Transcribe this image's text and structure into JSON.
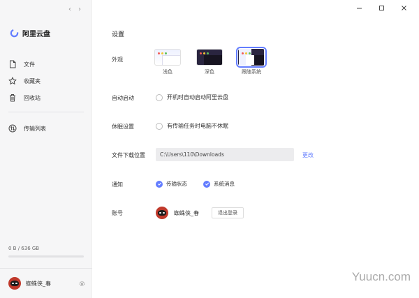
{
  "app": {
    "name": "阿里云盘"
  },
  "sidebar": {
    "items": [
      {
        "label": "文件",
        "icon": "file-icon"
      },
      {
        "label": "收藏夹",
        "icon": "star-icon"
      },
      {
        "label": "回收站",
        "icon": "trash-icon"
      },
      {
        "label": "传输列表",
        "icon": "transfer-icon"
      }
    ],
    "storage_text": "0 B / 636 GB",
    "storage_fraction": 0.0,
    "user_name": "蜘蛛侠_春"
  },
  "settings": {
    "title": "设置",
    "appearance": {
      "label": "外观",
      "options": [
        "浅色",
        "深色",
        "跟随系统"
      ],
      "selected": "跟随系统"
    },
    "autostart": {
      "label": "自动启动",
      "option": "开机时自动启动阿里云盘",
      "checked": false
    },
    "sleep": {
      "label": "休眠设置",
      "option": "有传输任务时电脑不休眠",
      "checked": false
    },
    "download": {
      "label": "文件下载位置",
      "path": "C:\\Users\\110\\Downloads",
      "change_label": "更改"
    },
    "notify": {
      "label": "通知",
      "options": [
        "传输状态",
        "系统消息"
      ],
      "checked": [
        true,
        true
      ]
    },
    "account": {
      "label": "账号",
      "name": "蜘蛛侠_春",
      "logout_label": "退出登录"
    }
  },
  "watermark": "Yuucn.com",
  "colors": {
    "accent": "#637dff",
    "sidebar_bg": "#f6f6f7"
  }
}
